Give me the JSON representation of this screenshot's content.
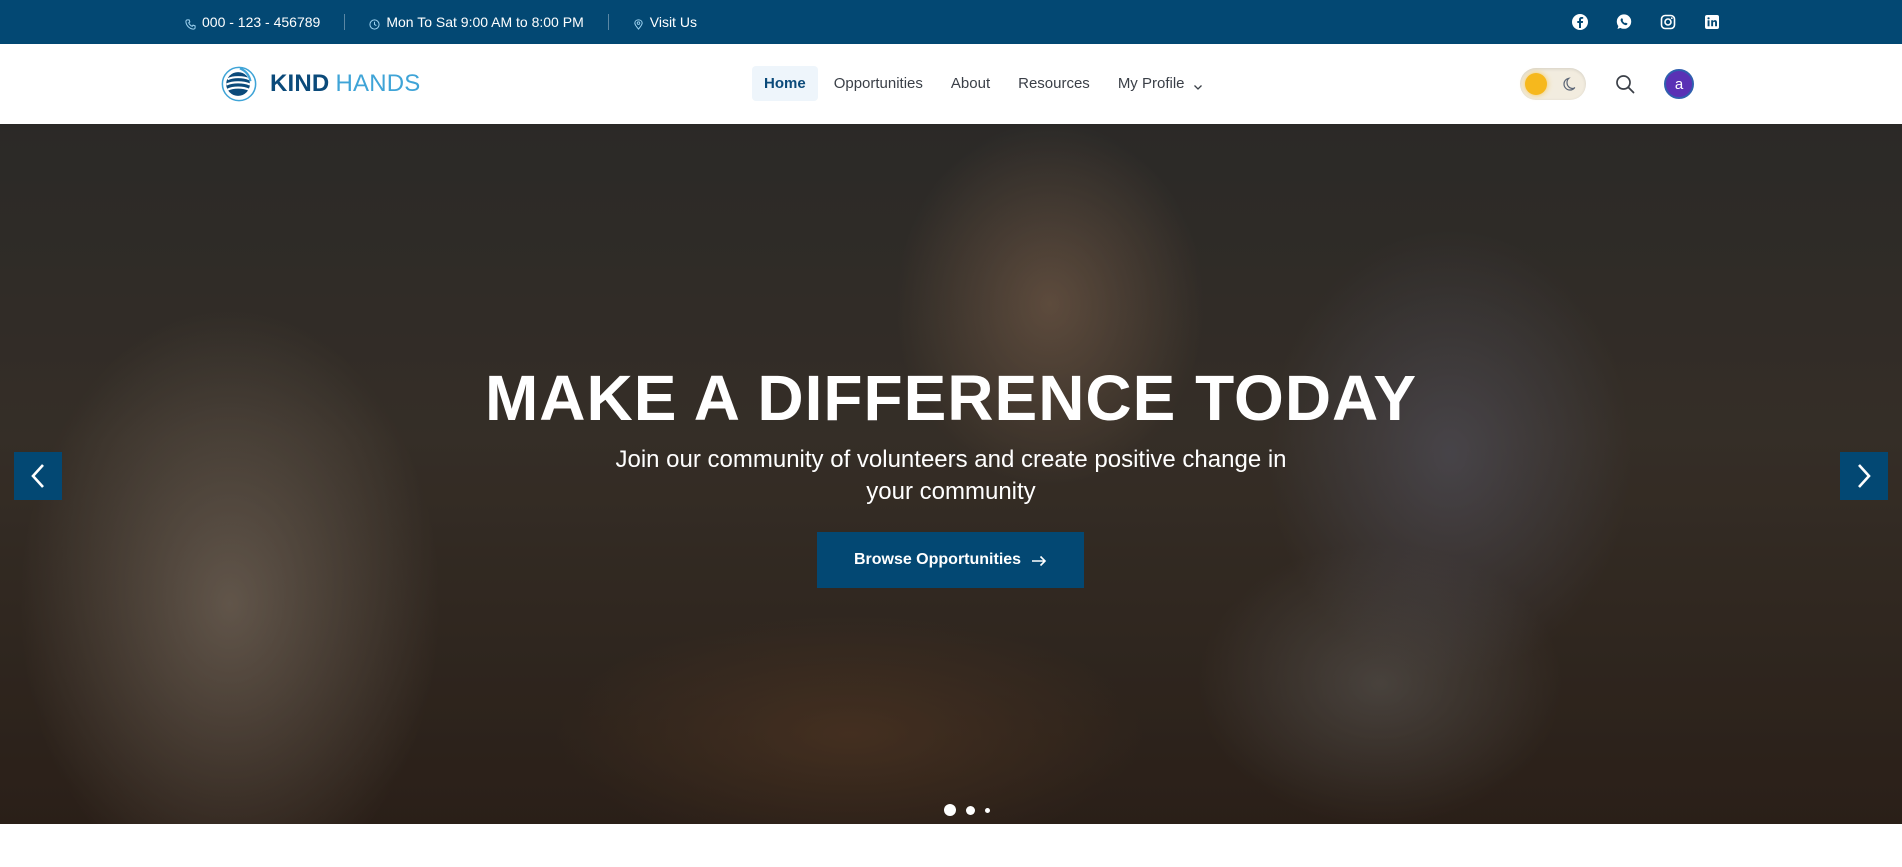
{
  "topbar": {
    "phone": "000 - 123 - 456789",
    "hours": "Mon To Sat 9:00 AM to 8:00 PM",
    "visit": "Visit Us",
    "social": [
      "facebook-icon",
      "whatsapp-icon",
      "instagram-icon",
      "linkedin-icon"
    ],
    "background": "#034873"
  },
  "header": {
    "logo_kind": "KIND",
    "logo_hands": "HANDS",
    "nav": [
      {
        "label": "Home",
        "active": true
      },
      {
        "label": "Opportunities",
        "active": false
      },
      {
        "label": "About",
        "active": false
      },
      {
        "label": "Resources",
        "active": false
      },
      {
        "label": "My Profile",
        "active": false,
        "dropdown": true
      }
    ],
    "theme_toggle": "light",
    "avatar_initial": "a"
  },
  "hero": {
    "title": "MAKE A DIFFERENCE TODAY",
    "subtitle": "Join our community of volunteers and create positive change in your community",
    "cta_label": "Browse Opportunities",
    "slides_count": 3,
    "active_slide": 1
  },
  "colors": {
    "primary": "#034873",
    "accent": "#3fa4d7",
    "sun": "#f6b81d",
    "avatar": "#5a31b5"
  }
}
